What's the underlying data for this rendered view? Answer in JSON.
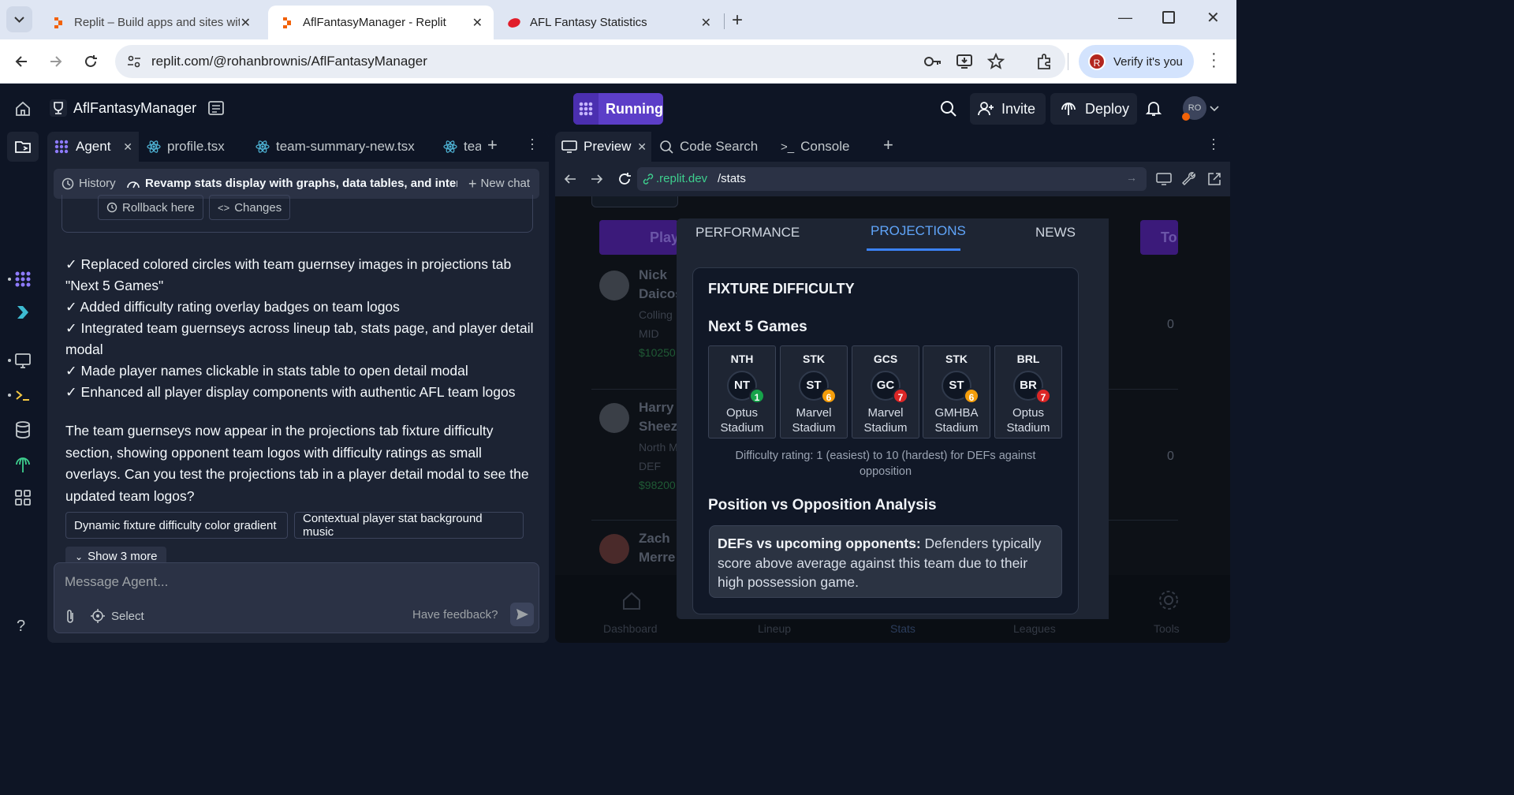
{
  "browser": {
    "tabs": [
      {
        "title": "Replit – Build apps and sites wit",
        "active": false
      },
      {
        "title": "AflFantasyManager - Replit",
        "active": true
      },
      {
        "title": "AFL Fantasy Statistics",
        "active": false
      }
    ],
    "url": "replit.com/@rohanbrownis/AflFantasyManager",
    "verify_label": "Verify it's you",
    "profile_initial": "R"
  },
  "replit": {
    "project_name": "AflFantasyManager",
    "running_label": "Running",
    "invite_label": "Invite",
    "deploy_label": "Deploy",
    "avatar_initials": "RO"
  },
  "agent": {
    "tabs": [
      {
        "label": "Agent"
      },
      {
        "label": "profile.tsx"
      },
      {
        "label": "team-summary-new.tsx"
      },
      {
        "label": "tea"
      }
    ],
    "history_label": "History",
    "chat_title": "Revamp stats display with graphs, data tables, and inter...",
    "new_chat_label": "New chat",
    "rollback_label": "Rollback here",
    "changes_label": "Changes",
    "checklist": [
      "✓ Replaced colored circles with team guernsey images in projections tab \"Next 5 Games\"",
      "✓ Added difficulty rating overlay badges on team logos",
      "✓ Integrated team guernseys across lineup tab, stats page, and player detail modal",
      "✓ Made player names clickable in stats table to open detail modal",
      "✓ Enhanced all player display components with authentic AFL team logos"
    ],
    "summary": "The team guernseys now appear in the projections tab fixture difficulty section, showing opponent team logos with difficulty ratings as small overlays. Can you test the projections tab in a player detail modal to see the updated team logos?",
    "suggestions": [
      "Dynamic fixture difficulty color gradient",
      "Contextual player stat background music"
    ],
    "show_more_label": "Show 3 more",
    "input_placeholder": "Message Agent...",
    "select_label": "Select",
    "feedback_label": "Have feedback?"
  },
  "preview": {
    "tabs": [
      {
        "label": "Preview"
      },
      {
        "label": "Code Search"
      },
      {
        "label": "Console"
      }
    ],
    "url_domain": ".replit.dev",
    "url_path": "/stats",
    "background": {
      "header_left": "Play",
      "header_right": "To",
      "players": [
        {
          "first": "Nick",
          "last": "Daicos",
          "club": "Colling",
          "pos": "MID",
          "price": "$10250",
          "value": "0"
        },
        {
          "first": "Harry",
          "last": "Sheez",
          "club": "North M",
          "pos": "DEF",
          "price": "$98200",
          "value": "0"
        },
        {
          "first": "Zach",
          "last": "Merre"
        }
      ],
      "nav": [
        "Dashboard",
        "Lineup",
        "Stats",
        "Leagues",
        "Tools"
      ]
    }
  },
  "modal": {
    "tabs": [
      "PERFORMANCE",
      "PROJECTIONS",
      "NEWS"
    ],
    "active_tab": "PROJECTIONS",
    "fixture_title": "FIXTURE DIFFICULTY",
    "next_games_title": "Next 5 Games",
    "games": [
      {
        "code": "NTH",
        "logo": "NT",
        "rating": "1",
        "venue_line1": "Optus",
        "venue_line2": "Stadium",
        "badge_color": "#16a34a"
      },
      {
        "code": "STK",
        "logo": "ST",
        "rating": "6",
        "venue_line1": "Marvel",
        "venue_line2": "Stadium",
        "badge_color": "#f59e0b"
      },
      {
        "code": "GCS",
        "logo": "GC",
        "rating": "7",
        "venue_line1": "Marvel",
        "venue_line2": "Stadium",
        "badge_color": "#dc2626"
      },
      {
        "code": "STK",
        "logo": "ST",
        "rating": "6",
        "venue_line1": "GMHBA",
        "venue_line2": "Stadium",
        "badge_color": "#f59e0b"
      },
      {
        "code": "BRL",
        "logo": "BR",
        "rating": "7",
        "venue_line1": "Optus",
        "venue_line2": "Stadium",
        "badge_color": "#dc2626"
      }
    ],
    "difficulty_note": "Difficulty rating: 1 (easiest) to 10 (hardest) for DEFs against opposition",
    "analysis_title": "Position vs Opposition Analysis",
    "analysis_lead": "DEFs vs upcoming opponents:",
    "analysis_text": " Defenders typically score above average against this team due to their high possession game."
  }
}
